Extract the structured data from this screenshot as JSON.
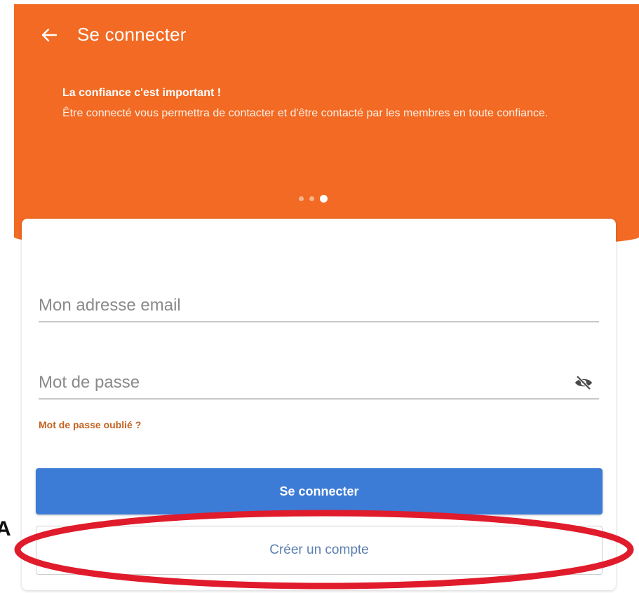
{
  "header": {
    "title": "Se connecter",
    "back_icon": "arrow-left-icon",
    "background_color": "#f26a23"
  },
  "intro": {
    "heading": "La confiance c'est important !",
    "text": "Être connecté vous permettra de contacter et d'être contacté par les membres en toute confiance."
  },
  "carousel": {
    "total": 3,
    "active_index": 2
  },
  "form": {
    "email_placeholder": "Mon adresse email",
    "email_value": "",
    "password_placeholder": "Mot de passe",
    "password_value": "",
    "password_toggle_icon": "eye-off-icon",
    "forgot_password_label": "Mot de passe oublié ?",
    "login_button_label": "Se connecter",
    "register_button_label": "Créer un compte",
    "login_button_color": "#3c7bd6"
  },
  "annotation": {
    "highlight_color": "#e01b2b",
    "edge_glyph": "A"
  }
}
